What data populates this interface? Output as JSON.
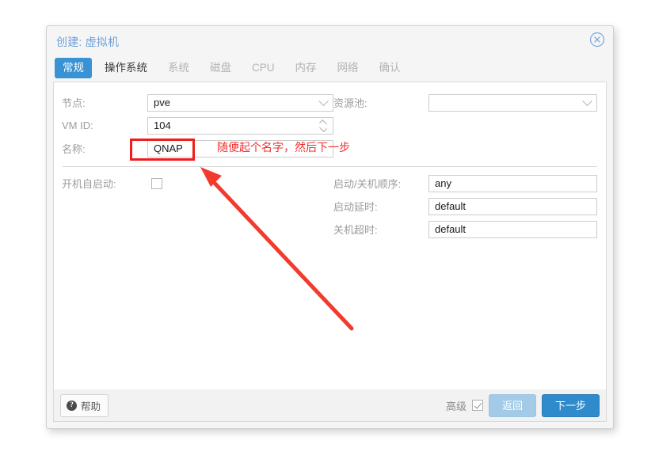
{
  "dialog": {
    "title": "创建: 虚拟机",
    "close_icon": "close-circle-icon"
  },
  "tabs": [
    {
      "label": "常规",
      "state": "active"
    },
    {
      "label": "操作系统",
      "state": "enabled"
    },
    {
      "label": "系统",
      "state": "disabled"
    },
    {
      "label": "磁盘",
      "state": "disabled"
    },
    {
      "label": "CPU",
      "state": "disabled"
    },
    {
      "label": "内存",
      "state": "disabled"
    },
    {
      "label": "网络",
      "state": "disabled"
    },
    {
      "label": "确认",
      "state": "disabled"
    }
  ],
  "form": {
    "node": {
      "label": "节点:",
      "value": "pve",
      "icon": "chevron-down-icon"
    },
    "vmid": {
      "label": "VM ID:",
      "value": "104",
      "icon": "spinner-icon"
    },
    "name": {
      "label": "名称:",
      "value": "QNAP"
    },
    "pool": {
      "label": "资源池:",
      "value": "",
      "icon": "chevron-down-icon"
    },
    "autostart": {
      "label": "开机自启动:",
      "checked": false
    },
    "start_order": {
      "label": "启动/关机顺序:",
      "value": "any"
    },
    "startup_delay": {
      "label": "启动延时:",
      "value": "default"
    },
    "shutdown_timeout": {
      "label": "关机超时:",
      "value": "default"
    }
  },
  "footer": {
    "help_label": "帮助",
    "help_icon": "question-circle-icon",
    "advanced_label": "高级",
    "advanced_checked": true,
    "back_label": "返回",
    "next_label": "下一步"
  },
  "annotation": {
    "text": "随便起个名字，然后下一步",
    "color": "#f22c2c"
  },
  "colors": {
    "accent": "#3892d4",
    "title": "#6f9fd8",
    "annotation": "#f01d1d"
  }
}
